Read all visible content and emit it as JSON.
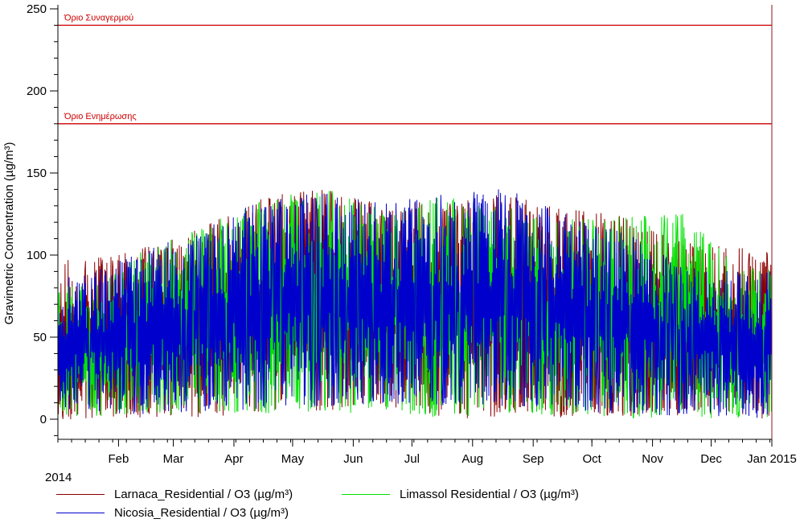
{
  "chart_data": {
    "type": "line",
    "title": "",
    "ylabel": "Gravimetric Concentration (µg/m³)",
    "ylim": [
      -12,
      252
    ],
    "yticks": [
      0,
      50,
      100,
      150,
      200,
      250
    ],
    "y_minor_step": 10,
    "x_start_label": "2014",
    "x_end_label": "Jan 2015",
    "x_range": [
      "2014-01-01",
      "2015-01-01"
    ],
    "months": [
      {
        "label": "Feb",
        "date": "2014-02-01"
      },
      {
        "label": "Mar",
        "date": "2014-03-01"
      },
      {
        "label": "Apr",
        "date": "2014-04-01"
      },
      {
        "label": "May",
        "date": "2014-05-01"
      },
      {
        "label": "Jun",
        "date": "2014-06-01"
      },
      {
        "label": "Jul",
        "date": "2014-07-01"
      },
      {
        "label": "Aug",
        "date": "2014-08-01"
      },
      {
        "label": "Sep",
        "date": "2014-09-01"
      },
      {
        "label": "Oct",
        "date": "2014-10-01"
      },
      {
        "label": "Nov",
        "date": "2014-11-01"
      },
      {
        "label": "Dec",
        "date": "2014-12-01"
      }
    ],
    "thresholds": [
      {
        "label": "Όριο Συναγερμού",
        "value": 240,
        "color": "#cc0000"
      },
      {
        "label": "Όριο Ενημέρωσης",
        "value": 180,
        "color": "#cc0000"
      }
    ],
    "series": [
      {
        "name": "Larnaca_Residential / O3 (µg/m³)",
        "color": "#8b0000",
        "monthly_min": [
          0,
          1,
          0,
          5,
          4,
          8,
          0,
          2,
          1,
          2,
          1,
          0
        ],
        "monthly_max": [
          97,
          105,
          118,
          136,
          140,
          130,
          134,
          138,
          128,
          124,
          108,
          104
        ]
      },
      {
        "name": "Limassol Residential / O3 (µg/m³)",
        "color": "#00e000",
        "monthly_min": [
          2,
          2,
          4,
          3,
          5,
          2,
          1,
          4,
          2,
          1,
          0,
          1
        ],
        "monthly_max": [
          82,
          104,
          119,
          134,
          141,
          128,
          136,
          130,
          122,
          124,
          125,
          92
        ]
      },
      {
        "name": "Nicosia_Residential / O3 (µg/m³)",
        "color": "#0000cc",
        "monthly_min": [
          3,
          3,
          5,
          6,
          7,
          10,
          8,
          6,
          4,
          3,
          2,
          1
        ],
        "monthly_max": [
          88,
          103,
          117,
          135,
          138,
          132,
          137,
          141,
          125,
          115,
          93,
          90
        ]
      }
    ]
  }
}
